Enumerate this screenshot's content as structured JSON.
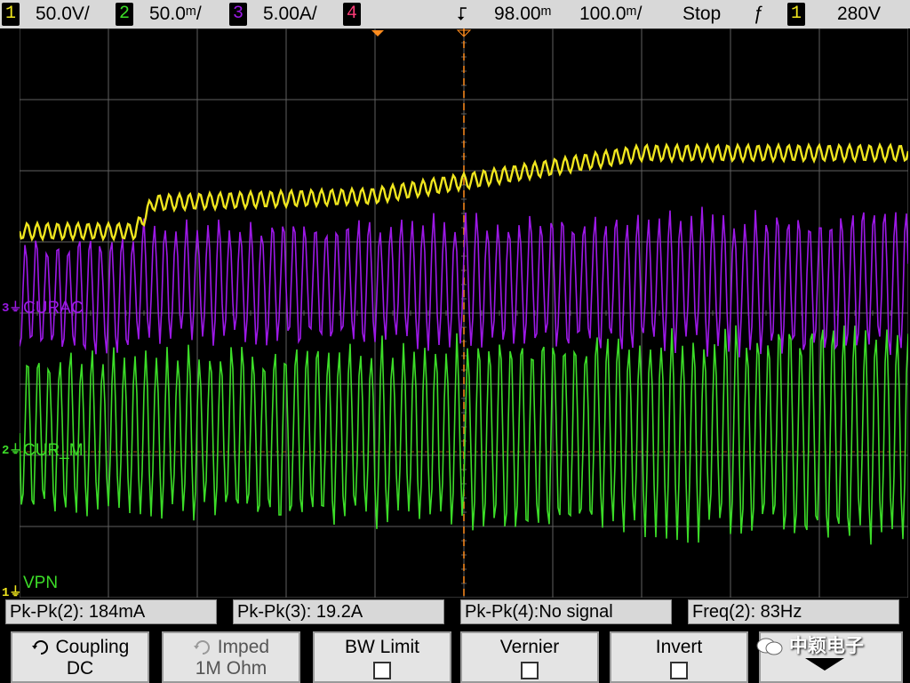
{
  "topbar": {
    "ch1_num": "1",
    "ch1_scale": "50.0V/",
    "ch2_num": "2",
    "ch2_scale": "50.0ᵐ/",
    "ch3_num": "3",
    "ch3_scale": "5.00A/",
    "ch4_num": "4",
    "delay": "98.00ᵐ",
    "timebase": "100.0ᵐ/",
    "run_state": "Stop",
    "trig_slope": "ƒ",
    "trig_source": "1",
    "trig_level": "280V"
  },
  "colors": {
    "ch1": "#f0e61e",
    "ch2": "#3cdc28",
    "ch3": "#9c19e6",
    "ch4": "#ff3c78",
    "grid": "#606060",
    "bar_bg": "#d8d8d8",
    "orange": "#ff8c1e"
  },
  "traces": {
    "ch3_label": "CURAC",
    "ch2_label": "CUR_M",
    "ch1_label": "VPN",
    "trigger_marker": "T",
    "ch3_marker": "3",
    "ch2_marker": "2",
    "ch1_marker": "1"
  },
  "measurements": [
    {
      "text": "Pk-Pk(2): 184mA"
    },
    {
      "text": "Pk-Pk(3): 19.2A"
    },
    {
      "text": "Pk-Pk(4):No signal"
    },
    {
      "text": "Freq(2): 83Hz"
    }
  ],
  "softkeys": {
    "coupling_label": "Coupling",
    "coupling_value": "DC",
    "imped_label": "Imped",
    "imped_value": "1M Ohm",
    "bwlimit_label": "BW Limit",
    "vernier_label": "Vernier",
    "invert_label": "Invert"
  },
  "watermark": "中颖电子"
}
